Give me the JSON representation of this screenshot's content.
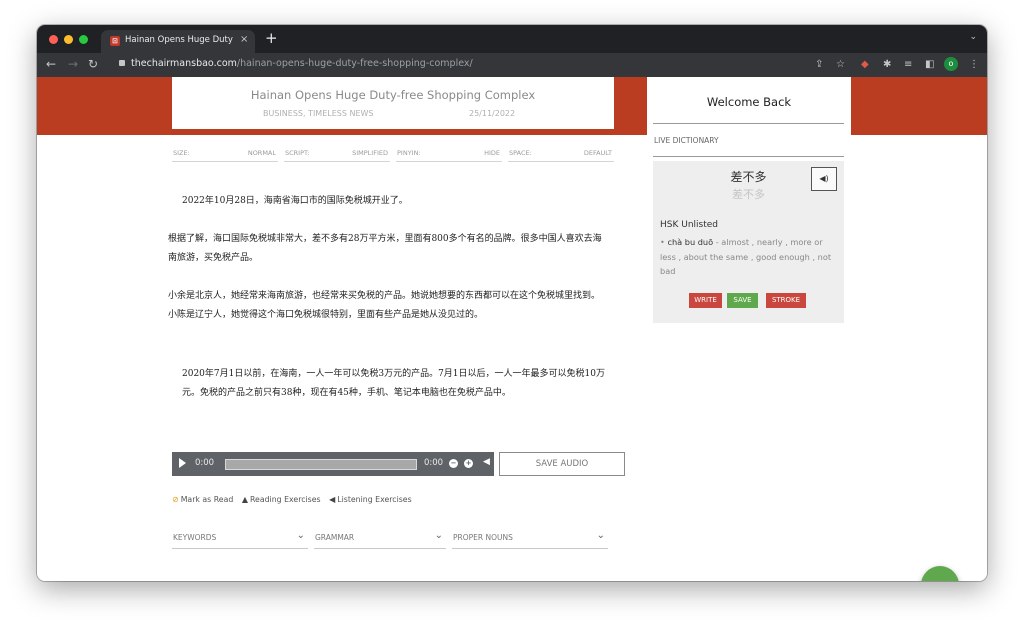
{
  "browser": {
    "tab_title": "Hainan Opens Huge Duty-free Shopping Complex",
    "tab_favicon": "TCB",
    "tab_close": "×",
    "new_tab": "+",
    "url_host": "thechairmansbao.com",
    "url_path": "/hainan-opens-huge-duty-free-shopping-complex/",
    "profile_initial": "o",
    "ext_badge": "4"
  },
  "article": {
    "title": "Hainan Opens Huge Duty-free Shopping Complex",
    "category": "BUSINESS, TIMELESS NEWS",
    "date": "25/11/2022",
    "settings": [
      {
        "label": "SIZE:",
        "value": "NORMAL"
      },
      {
        "label": "SCRIPT:",
        "value": "SIMPLIFIED"
      },
      {
        "label": "PINYIN:",
        "value": "HIDE"
      },
      {
        "label": "SPACE:",
        "value": "DEFAULT"
      }
    ],
    "paragraphs": [
      "2022年10月28日，海南省海口市的国际免税城开业了。",
      "根据了解，海口国际免税城非常大，差不多有28万平方米，里面有800多个有名的品牌。很多中国人喜欢去海南旅游，买免税产品。",
      "小余是北京人，她经常来海南旅游，也经常来买免税的产品。她说她想要的东西都可以在这个免税城里找到。小陈是辽宁人，她觉得这个海口免税城很特别，里面有些产品是她从没见过的。",
      "2020年7月1日以前，在海南，一人一年可以免税3万元的产品。7月1日以后，一人一年最多可以免税10万元。免税的产品之前只有38种，现在有45种，手机、笔记本电脑也在免税产品中。"
    ],
    "audio": {
      "current_time": "0:00",
      "duration": "0:00",
      "save_label": "SAVE AUDIO"
    },
    "links": {
      "mark_read": "Mark as Read",
      "reading": "Reading Exercises",
      "listening": "Listening Exercises"
    },
    "dropdowns": {
      "keywords": "KEYWORDS",
      "grammar": "GRAMMAR",
      "proper_nouns": "PROPER NOUNS"
    }
  },
  "sidebar": {
    "welcome": "Welcome Back",
    "live_dictionary": "LIVE DICTIONARY",
    "word": "差不多",
    "word_alt": "差不多",
    "hsk": "HSK Unlisted",
    "pinyin": "chà bu duō",
    "definition": "- almost , nearly , more or less , about the same , good enough , not bad",
    "buttons": {
      "write": "WRITE",
      "save": "SAVE",
      "stroke": "STROKE"
    },
    "colors": {
      "write": "#c9473e",
      "save": "#5fa84e",
      "stroke": "#c9473e"
    }
  },
  "colors": {
    "brand_orange": "#ba3d21",
    "fab_green": "#5fa84e"
  }
}
